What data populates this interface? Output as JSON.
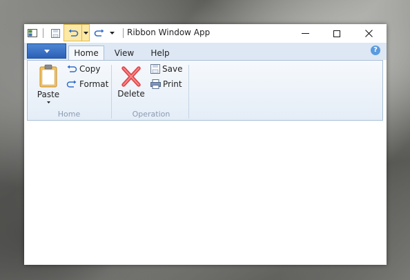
{
  "window": {
    "title": "Ribbon Window App",
    "controls": {
      "minimize": "—",
      "maximize": "☐",
      "close": "✕"
    }
  },
  "qat": {
    "icons": [
      "app-icon",
      "save-icon",
      "undo-icon",
      "dropdown-arrow-icon",
      "redo-icon",
      "customize-icon"
    ]
  },
  "ribbon": {
    "tabs": [
      {
        "label": "Home",
        "active": true
      },
      {
        "label": "View",
        "active": false
      },
      {
        "label": "Help",
        "active": false
      }
    ],
    "help_glyph": "?",
    "groups": [
      {
        "label": "Home",
        "large": {
          "label": "Paste",
          "icon": "clipboard-icon"
        },
        "small": [
          {
            "label": "Copy",
            "icon": "copy-arrow-icon"
          },
          {
            "label": "Format",
            "icon": "format-arrow-icon"
          }
        ]
      },
      {
        "label": "Operation",
        "large": {
          "label": "Delete",
          "icon": "delete-x-icon"
        },
        "small": [
          {
            "label": "Save",
            "icon": "floppy-icon"
          },
          {
            "label": "Print",
            "icon": "printer-icon"
          }
        ]
      }
    ]
  },
  "colors": {
    "ribbon_tab_bg": "#dde8f4",
    "app_button": "#2a61b8",
    "accent": "#3d78c9"
  }
}
